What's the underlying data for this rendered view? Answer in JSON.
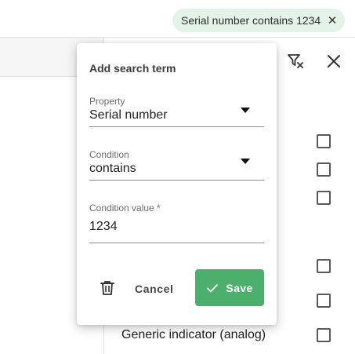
{
  "filter_chip": {
    "label": "Serial number contains 1234",
    "remove_icon": "close-icon"
  },
  "toolbar": {
    "clear_filters_icon": "filter-clear-icon",
    "close_icon": "close-icon"
  },
  "list": {
    "visible_item_label": "Generic indicator (analog)",
    "checkbox_count": 6
  },
  "search_popover": {
    "title": "Add search term",
    "property": {
      "label": "Property",
      "value": "Serial number"
    },
    "condition": {
      "label": "Condition",
      "value": "contains"
    },
    "condition_value": {
      "label": "Condition value *",
      "value": "1234"
    },
    "delete_icon": "trash-icon",
    "cancel_label": "Cancel",
    "save_label": "Save",
    "save_icon": "check-icon"
  },
  "colors": {
    "accent": "#4cb06c",
    "chip_bg": "#e4f3e7"
  }
}
